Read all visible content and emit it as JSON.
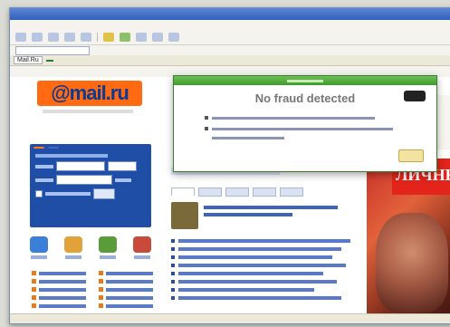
{
  "popup": {
    "title": "No fraud detected"
  },
  "bookmarks": {
    "item1": "Mail.Ru",
    "item2": ""
  },
  "site": {
    "logo": "@mail.ru"
  },
  "mailbox": {
    "tab1": "",
    "tab2": ""
  },
  "promo": {
    "headline": "ЛИЧНЫЙ"
  },
  "colors": {
    "brand": "#ff6a13",
    "link": "#1f4ea6",
    "popup_ok": "#3e9a2d"
  }
}
